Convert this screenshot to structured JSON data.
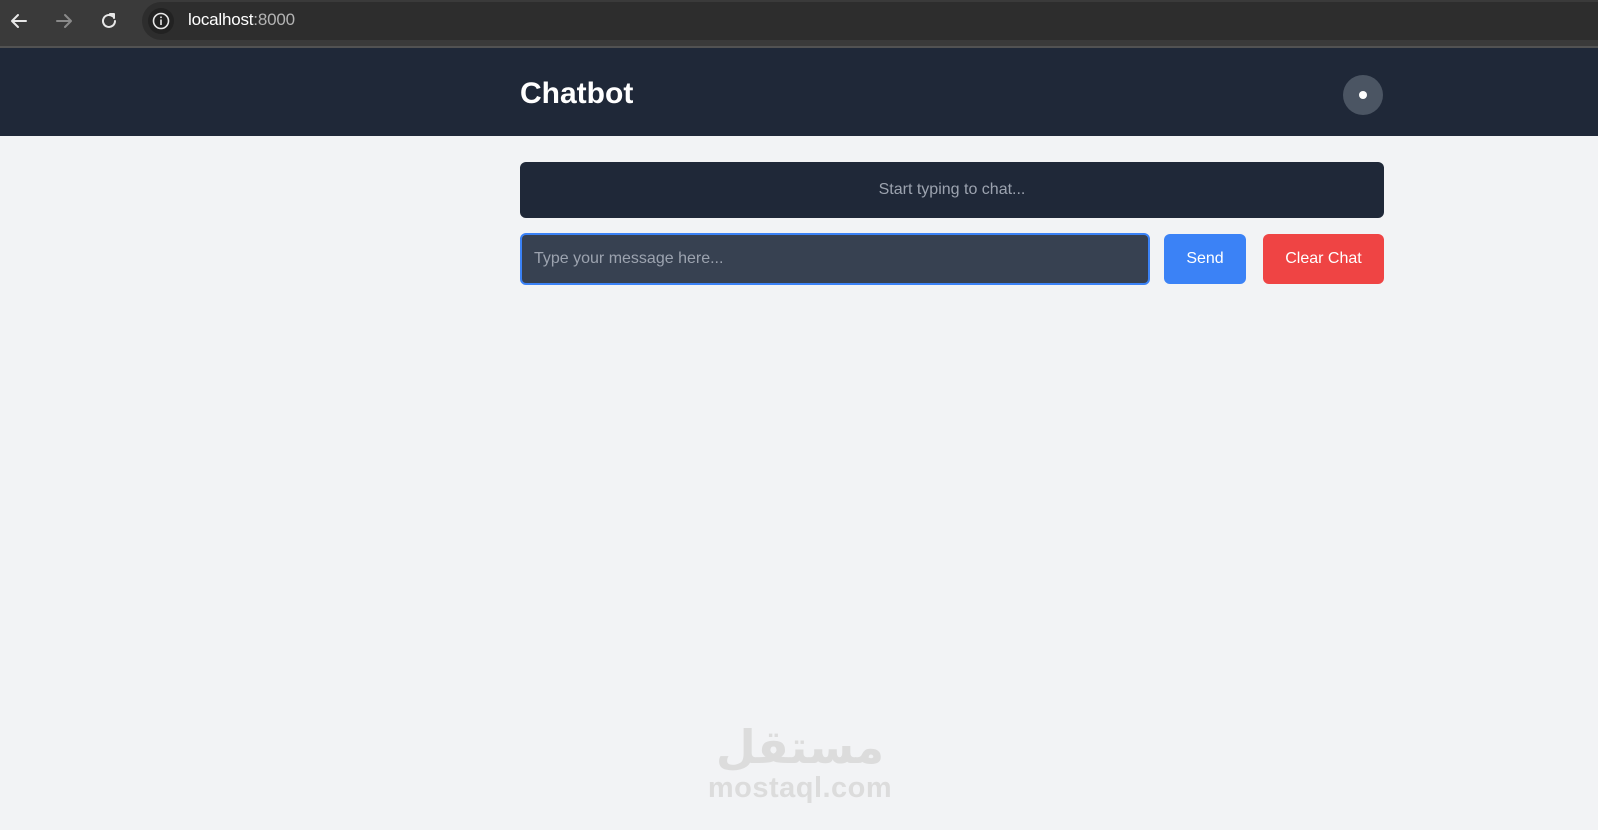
{
  "browser": {
    "url_host": "localhost",
    "url_port": ":8000",
    "back_icon": "arrow-left-icon",
    "forward_icon": "arrow-right-icon",
    "reload_icon": "reload-icon",
    "info_icon": "info-icon"
  },
  "header": {
    "title": "Chatbot",
    "toggle_icon": "theme-toggle-icon"
  },
  "chat": {
    "empty_text": "Start typing to chat..."
  },
  "input": {
    "placeholder": "Type your message here...",
    "value": ""
  },
  "buttons": {
    "send_label": "Send",
    "clear_label": "Clear Chat"
  },
  "watermark": {
    "arabic": "مستقل",
    "latin": "mostaql.com"
  },
  "colors": {
    "header_bg": "#1f2838",
    "page_bg": "#f2f3f5",
    "send": "#3b82f6",
    "clear": "#ef4444",
    "input_bg": "#374151"
  }
}
